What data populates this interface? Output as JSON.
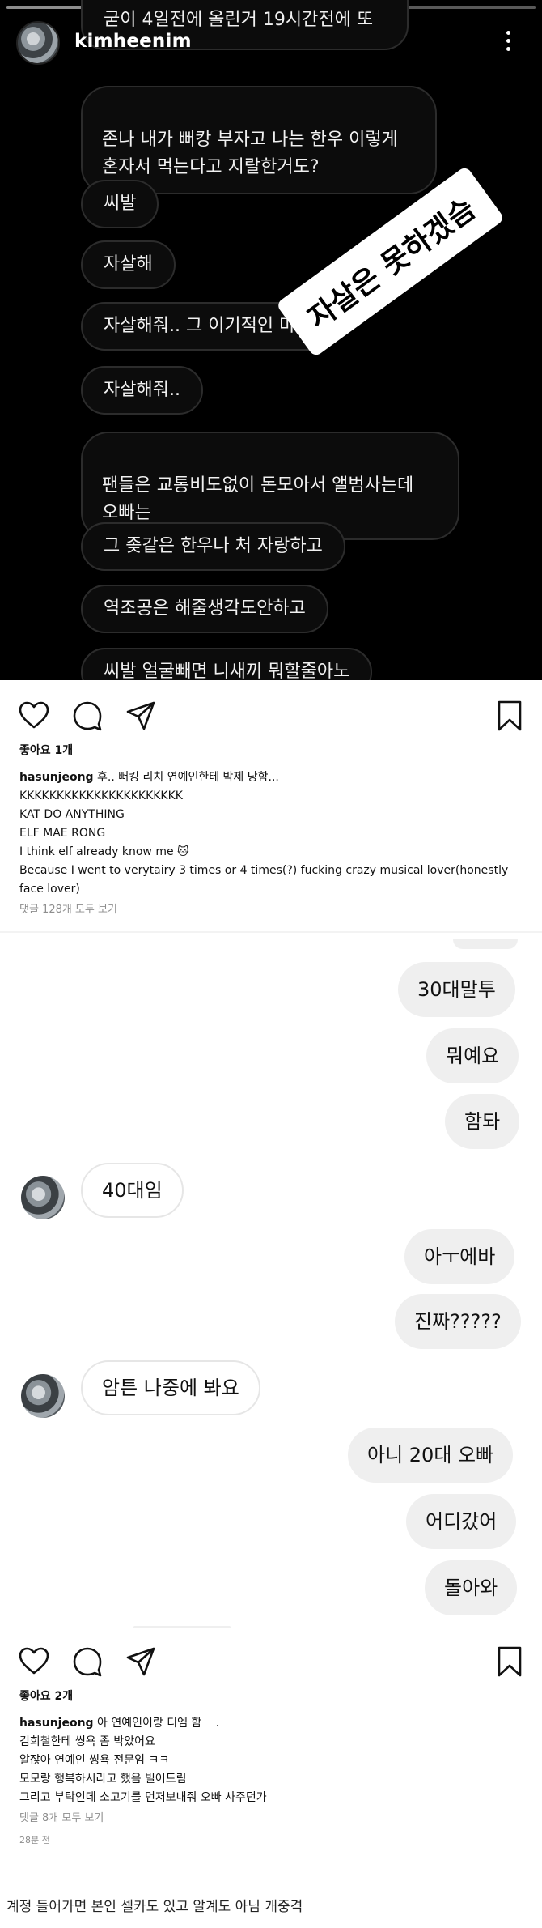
{
  "story": {
    "username": "kimheenim",
    "messages": [
      "굳이 4일전에 올린거 19시간전에 또",
      "존나 내가 뻐캉 부자고 나는 한우 이렇게\n혼자서 먹는다고 지랄한거도?",
      "씨발",
      "자살해",
      "자살해줘.. 그 이기적인 마음",
      "자살해줘..",
      "팬들은 교통비도없이 돈모아서 앨범사는데\n오빠는",
      "그 좆같은 한우나 처 자랑하고",
      "역조공은 해줄생각도안하고",
      "씨발 얼굴빼면 니새끼 뭐할줄아노"
    ],
    "sticker_text": "자살은 못하겠슴"
  },
  "post1": {
    "likes": "좋아요 1개",
    "username": "hasunjeong",
    "caption_first": "후.. 뻐킹 리치 연예인한테 박제 당함...",
    "lines": [
      "KKKKKKKKKKKKKKKKKKKKKK",
      "KAT DO ANYTHING",
      "ELF MAE RONG",
      "I think elf already know me 🐱",
      "Because I went to verytairy 3 times or 4 times(?) fucking crazy musical lover(honestly",
      "face lover)"
    ],
    "comments": "댓글 128개 모두 보기"
  },
  "dm": {
    "outgoing_1": [
      "30대말투",
      "뭐예요",
      "함돠"
    ],
    "incoming_1": "40대임",
    "outgoing_2": [
      "아ㅜ에바",
      "진짜?????"
    ],
    "incoming_2": "암튼 나중에 봐요",
    "outgoing_3": [
      "아니 20대 오빠",
      "어디갔어",
      "돌아와"
    ]
  },
  "post2": {
    "likes": "좋아요 2개",
    "username": "hasunjeong",
    "caption_first": "아 연예인이랑 디엠 함 ㅡ.ㅡ",
    "lines": [
      "김희철한테 씽욕 좀 박았어요",
      "알잖아 연예인 씽욕 전문임 ㅋㅋ",
      "모모랑 행복하시라고 했음 빌어드림",
      "그리고 부탁인데 소고기를 먼저보내줘 오빠 사주던가"
    ],
    "comments": "댓글 8개 모두 보기",
    "time": "28분 전"
  },
  "footer_caption": "계정 들어가면 본인 셀카도 있고 알계도 아님 개중격"
}
